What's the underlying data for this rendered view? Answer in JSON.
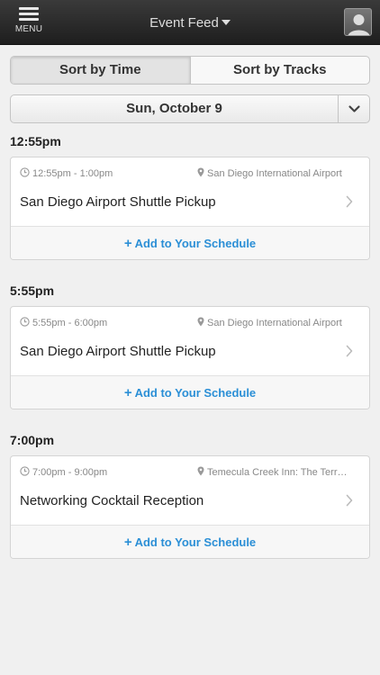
{
  "header": {
    "menu_label": "MENU",
    "title": "Event Feed"
  },
  "sort_tabs": [
    {
      "label": "Sort by Time",
      "active": true
    },
    {
      "label": "Sort by Tracks",
      "active": false
    }
  ],
  "date_selector": {
    "value": "Sun, October 9"
  },
  "add_label": "Add to Your Schedule",
  "groups": [
    {
      "heading": "12:55pm",
      "event": {
        "time": "12:55pm - 1:00pm",
        "location": "San Diego International Airport",
        "name": "San Diego Airport Shuttle Pickup"
      }
    },
    {
      "heading": "5:55pm",
      "event": {
        "time": "5:55pm - 6:00pm",
        "location": "San Diego International Airport",
        "name": "San Diego Airport Shuttle Pickup"
      }
    },
    {
      "heading": "7:00pm",
      "event": {
        "time": "7:00pm - 9:00pm",
        "location": "Temecula Creek Inn: The Terrace",
        "name": "Networking Cocktail Reception"
      }
    }
  ],
  "colors": {
    "accent": "#2b8fd6",
    "topbar": "#2b2b2b",
    "background": "#f0f0f0"
  },
  "icons": {
    "menu": "hamburger-icon",
    "profile": "user-avatar-icon",
    "dropdown": "chevron-down-icon",
    "clock": "clock-icon",
    "location": "map-pin-icon",
    "disclosure": "chevron-right-icon",
    "add": "plus-icon"
  }
}
